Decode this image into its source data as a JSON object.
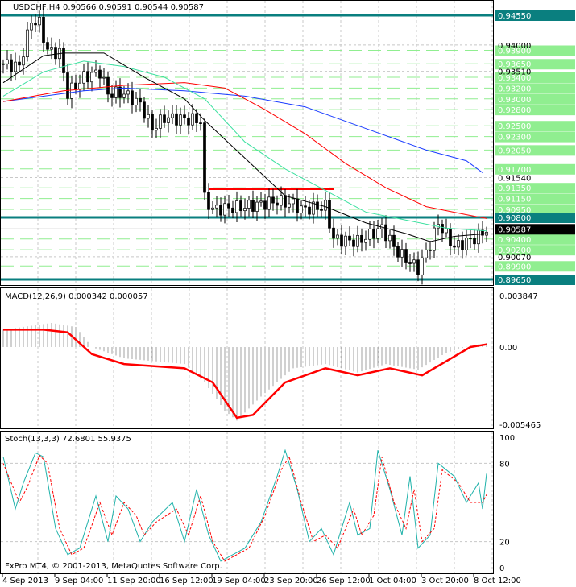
{
  "chart_header": {
    "symbol": "USDCHF,H4",
    "ohlc": "0.90566 0.90591 0.90544 0.90587"
  },
  "macd_header": "MACD(12,26,9) 0.000342 0.000057",
  "stoch_header": "Stoch(13,3,3) 72.6801 55.9375",
  "copyright": "FxPro MT4, © 2001-2013, MetaQuotes Software Corp.",
  "colors": {
    "teal": "#0a7f7f",
    "green_level": "#90ee90",
    "red": "#ff0000",
    "blue": "#1a3cff",
    "ma_green": "#3ce0a0",
    "black": "#000000"
  },
  "chart_data": [
    {
      "type": "candlestick",
      "title": "USDCHF,H4",
      "ylim": [
        0.8958,
        0.949
      ],
      "price_labels": [
        "0.94000",
        "0.93510",
        "0.91540",
        "0.90070"
      ],
      "teal_levels": [
        {
          "value": 0.9455,
          "label": "0.94550"
        },
        {
          "value": 0.908,
          "label": "0.90800"
        },
        {
          "value": 0.8965,
          "label": "0.89650"
        }
      ],
      "green_levels": [
        {
          "value": 0.939,
          "label": "0.93900"
        },
        {
          "value": 0.9365,
          "label": "0.93650"
        },
        {
          "value": 0.934,
          "label": "0.93400"
        },
        {
          "value": 0.932,
          "label": "0.93200"
        },
        {
          "value": 0.93,
          "label": "0.93000"
        },
        {
          "value": 0.928,
          "label": "0.92800"
        },
        {
          "value": 0.925,
          "label": "0.92500"
        },
        {
          "value": 0.923,
          "label": "0.92300"
        },
        {
          "value": 0.9205,
          "label": "0.92050"
        },
        {
          "value": 0.917,
          "label": "0.91700"
        },
        {
          "value": 0.9135,
          "label": "0.91350"
        },
        {
          "value": 0.9115,
          "label": "0.91150"
        },
        {
          "value": 0.9095,
          "label": "0.90950"
        },
        {
          "value": 0.904,
          "label": "0.90400"
        },
        {
          "value": 0.902,
          "label": "0.90200"
        },
        {
          "value": 0.899,
          "label": "0.89900"
        }
      ],
      "current_price": {
        "value": 0.90587,
        "label": "0.90587"
      },
      "resistance": {
        "value": 0.9133,
        "from": 51,
        "to": 82
      },
      "close_path": [
        [
          0,
          0.9365
        ],
        [
          4,
          0.936
        ],
        [
          7,
          0.9445
        ],
        [
          9,
          0.944
        ],
        [
          11,
          0.939
        ],
        [
          14,
          0.9385
        ],
        [
          16,
          0.931
        ],
        [
          20,
          0.934
        ],
        [
          24,
          0.935
        ],
        [
          26,
          0.931
        ],
        [
          30,
          0.931
        ],
        [
          34,
          0.929
        ],
        [
          37,
          0.9245
        ],
        [
          40,
          0.9265
        ],
        [
          49,
          0.926
        ],
        [
          50,
          0.9115
        ],
        [
          52,
          0.9095
        ],
        [
          60,
          0.91
        ],
        [
          68,
          0.911
        ],
        [
          72,
          0.9105
        ],
        [
          74,
          0.9095
        ],
        [
          80,
          0.91
        ],
        [
          82,
          0.904
        ],
        [
          88,
          0.9035
        ],
        [
          94,
          0.906
        ],
        [
          98,
          0.9015
        ],
        [
          103,
          0.8985
        ],
        [
          106,
          0.903
        ],
        [
          108,
          0.907
        ],
        [
          112,
          0.9025
        ],
        [
          118,
          0.9045
        ],
        [
          120,
          0.9058
        ]
      ],
      "ma_fast": [
        [
          0,
          0.933
        ],
        [
          10,
          0.938
        ],
        [
          15,
          0.9385
        ],
        [
          25,
          0.9385
        ],
        [
          35,
          0.934
        ],
        [
          45,
          0.93
        ],
        [
          50,
          0.926
        ],
        [
          60,
          0.919
        ],
        [
          70,
          0.912
        ],
        [
          80,
          0.91
        ],
        [
          90,
          0.907
        ],
        [
          100,
          0.905
        ],
        [
          106,
          0.9035
        ],
        [
          112,
          0.9045
        ],
        [
          120,
          0.905
        ]
      ],
      "ma_green": [
        [
          0,
          0.9305
        ],
        [
          10,
          0.935
        ],
        [
          20,
          0.937
        ],
        [
          30,
          0.936
        ],
        [
          40,
          0.934
        ],
        [
          50,
          0.93
        ],
        [
          60,
          0.922
        ],
        [
          70,
          0.917
        ],
        [
          80,
          0.913
        ],
        [
          90,
          0.909
        ],
        [
          100,
          0.9075
        ],
        [
          110,
          0.906
        ],
        [
          120,
          0.9055
        ]
      ],
      "ma_red": [
        [
          0,
          0.9295
        ],
        [
          15,
          0.9315
        ],
        [
          30,
          0.9325
        ],
        [
          45,
          0.933
        ],
        [
          55,
          0.932
        ],
        [
          65,
          0.928
        ],
        [
          75,
          0.9235
        ],
        [
          85,
          0.918
        ],
        [
          95,
          0.9135
        ],
        [
          105,
          0.91
        ],
        [
          115,
          0.9085
        ],
        [
          120,
          0.9078
        ]
      ],
      "ma_blue": [
        [
          0,
          0.9295
        ],
        [
          20,
          0.9315
        ],
        [
          30,
          0.932
        ],
        [
          45,
          0.9315
        ],
        [
          60,
          0.9305
        ],
        [
          75,
          0.9285
        ],
        [
          90,
          0.9245
        ],
        [
          105,
          0.9205
        ],
        [
          115,
          0.9185
        ],
        [
          119,
          0.9163
        ]
      ]
    },
    {
      "type": "line",
      "title": "MACD(12,26,9)",
      "ylim": [
        -0.005465,
        0.003847
      ],
      "tick_labels": [
        "0.003847",
        "0.00",
        "-0.005465"
      ],
      "histogram_path": [
        [
          0,
          0.0013
        ],
        [
          12,
          0.0018
        ],
        [
          18,
          0.0015
        ],
        [
          22,
          0.0
        ],
        [
          30,
          -0.0008
        ],
        [
          45,
          -0.0012
        ],
        [
          50,
          -0.0025
        ],
        [
          55,
          -0.0045
        ],
        [
          58,
          -0.0052
        ],
        [
          64,
          -0.0035
        ],
        [
          72,
          -0.0015
        ],
        [
          80,
          -0.0012
        ],
        [
          88,
          -0.0018
        ],
        [
          95,
          -0.0012
        ],
        [
          103,
          -0.0016
        ],
        [
          110,
          -0.0004
        ],
        [
          116,
          0.0001
        ],
        [
          120,
          0.0003
        ]
      ],
      "signal_path": [
        [
          0,
          0.0013
        ],
        [
          10,
          0.0013
        ],
        [
          16,
          0.0011
        ],
        [
          22,
          -0.0005
        ],
        [
          30,
          -0.0012
        ],
        [
          45,
          -0.0015
        ],
        [
          52,
          -0.0025
        ],
        [
          58,
          -0.005
        ],
        [
          62,
          -0.0048
        ],
        [
          70,
          -0.0025
        ],
        [
          80,
          -0.0015
        ],
        [
          88,
          -0.002
        ],
        [
          96,
          -0.0015
        ],
        [
          104,
          -0.002
        ],
        [
          110,
          -0.001
        ],
        [
          116,
          0.0
        ],
        [
          120,
          0.0002
        ]
      ]
    },
    {
      "type": "line",
      "title": "Stoch(13,3,3)",
      "ylim": [
        0,
        100
      ],
      "tick_labels": [
        "100",
        "80",
        "20",
        "0"
      ],
      "main": [
        [
          0,
          85
        ],
        [
          3,
          45
        ],
        [
          5,
          65
        ],
        [
          8,
          88
        ],
        [
          10,
          85
        ],
        [
          13,
          30
        ],
        [
          16,
          10
        ],
        [
          19,
          15
        ],
        [
          23,
          55
        ],
        [
          26,
          20
        ],
        [
          28,
          55
        ],
        [
          31,
          45
        ],
        [
          34,
          20
        ],
        [
          37,
          35
        ],
        [
          42,
          50
        ],
        [
          45,
          20
        ],
        [
          48,
          60
        ],
        [
          51,
          25
        ],
        [
          54,
          5
        ],
        [
          57,
          10
        ],
        [
          60,
          15
        ],
        [
          64,
          35
        ],
        [
          68,
          70
        ],
        [
          70,
          90
        ],
        [
          73,
          60
        ],
        [
          76,
          20
        ],
        [
          79,
          30
        ],
        [
          82,
          10
        ],
        [
          86,
          50
        ],
        [
          88,
          25
        ],
        [
          91,
          30
        ],
        [
          93,
          90
        ],
        [
          96,
          60
        ],
        [
          99,
          25
        ],
        [
          101,
          70
        ],
        [
          103,
          15
        ],
        [
          106,
          25
        ],
        [
          108,
          80
        ],
        [
          112,
          70
        ],
        [
          115,
          50
        ],
        [
          118,
          65
        ],
        [
          119,
          45
        ],
        [
          120,
          72
        ]
      ],
      "signal": [
        [
          0,
          80
        ],
        [
          4,
          50
        ],
        [
          6,
          62
        ],
        [
          9,
          86
        ],
        [
          11,
          80
        ],
        [
          14,
          30
        ],
        [
          17,
          10
        ],
        [
          20,
          15
        ],
        [
          24,
          50
        ],
        [
          27,
          25
        ],
        [
          30,
          50
        ],
        [
          33,
          40
        ],
        [
          35,
          25
        ],
        [
          38,
          35
        ],
        [
          43,
          45
        ],
        [
          46,
          25
        ],
        [
          49,
          55
        ],
        [
          52,
          20
        ],
        [
          55,
          5
        ],
        [
          58,
          10
        ],
        [
          61,
          15
        ],
        [
          65,
          40
        ],
        [
          69,
          75
        ],
        [
          71,
          85
        ],
        [
          74,
          50
        ],
        [
          77,
          20
        ],
        [
          80,
          25
        ],
        [
          83,
          15
        ],
        [
          87,
          45
        ],
        [
          89,
          25
        ],
        [
          92,
          40
        ],
        [
          94,
          85
        ],
        [
          97,
          50
        ],
        [
          100,
          30
        ],
        [
          102,
          60
        ],
        [
          104,
          20
        ],
        [
          107,
          30
        ],
        [
          109,
          75
        ],
        [
          113,
          65
        ],
        [
          116,
          50
        ],
        [
          119,
          50
        ],
        [
          120,
          56
        ]
      ]
    }
  ],
  "x_labels": [
    "4 Sep 2013",
    "9 Sep 04:00",
    "11 Sep 20:00",
    "16 Sep 12:00",
    "19 Sep 04:00",
    "23 Sep 20:00",
    "26 Sep 12:00",
    "1 Oct 04:00",
    "3 Oct 20:00",
    "8 Oct 12:00"
  ]
}
